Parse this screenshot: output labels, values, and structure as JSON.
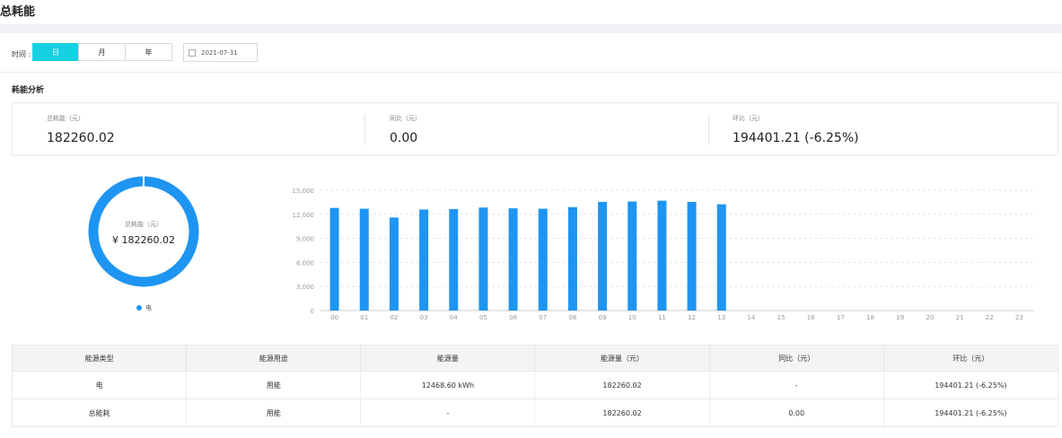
{
  "page": {
    "title": "总耗能"
  },
  "toolbar": {
    "time_label": "时间 :",
    "period_tabs": [
      {
        "label": "日",
        "active": true
      },
      {
        "label": "月",
        "active": false
      },
      {
        "label": "年",
        "active": false
      }
    ],
    "date_value": "2021-07-31"
  },
  "section": {
    "title": "耗能分析"
  },
  "summary": [
    {
      "label": "总耗能（元）",
      "value": "182260.02"
    },
    {
      "label": "同比（元）",
      "value": "0.00"
    },
    {
      "label": "环比（元）",
      "value": "194401.21 (-6.25%)"
    }
  ],
  "donut": {
    "label": "总耗能（元）",
    "value": "¥ 182260.02",
    "legend": "电",
    "color": "#1e95f2",
    "share": 1.0
  },
  "chart_data": {
    "type": "bar",
    "categories": [
      "00",
      "01",
      "02",
      "03",
      "04",
      "05",
      "06",
      "07",
      "08",
      "09",
      "10",
      "11",
      "12",
      "13",
      "14",
      "15",
      "16",
      "17",
      "18",
      "19",
      "20",
      "21",
      "22",
      "23"
    ],
    "values": [
      12800,
      12700,
      11600,
      12600,
      12650,
      12850,
      12750,
      12700,
      12900,
      13550,
      13600,
      13700,
      13550,
      13250,
      null,
      null,
      null,
      null,
      null,
      null,
      null,
      null,
      null,
      null
    ],
    "y_ticks": [
      "0",
      "3,000",
      "6,000",
      "9,000",
      "12,000",
      "15,000"
    ],
    "ylim": [
      0,
      15000
    ],
    "grid": true,
    "color": "#1e95f2"
  },
  "table": {
    "headers": [
      "能源类型",
      "能源用途",
      "能源量",
      "能源量（元）",
      "同比（元）",
      "环比（元）"
    ],
    "rows": [
      [
        "电",
        "用能",
        "12468.60 kWh",
        "182260.02",
        "-",
        "194401.21 (-6.25%)"
      ],
      [
        "总能耗",
        "用能",
        "-",
        "182260.02",
        "0.00",
        "194401.21 (-6.25%)"
      ]
    ]
  }
}
